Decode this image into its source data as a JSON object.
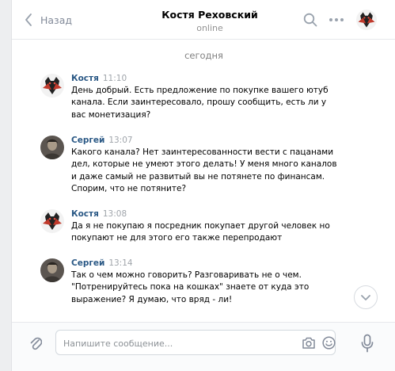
{
  "header": {
    "back_label": "Назад",
    "contact_name": "Костя Реховский",
    "status": "online"
  },
  "date_separator": "сегодня",
  "messages": [
    {
      "author": "Костя",
      "time": "11:10",
      "avatar": "kostya",
      "text": "День добрый. Есть предложение по покупке вашего ютуб канала. Если заинтересовало, прошу сообщить, есть ли у вас монетизация?"
    },
    {
      "author": "Сергей",
      "time": "13:07",
      "avatar": "sergey",
      "text": "Какого канала? Нет заинтересованности вести с пацанами дел, которые не умеют этого делать! У меня много каналов и даже самый не развитый вы не потянете по финансам. Спорим, что не потяните?"
    },
    {
      "author": "Костя",
      "time": "13:08",
      "avatar": "kostya",
      "text": "Да я не покупаю я посредник покупает другой человек но покупают не для этого его также перепродают"
    },
    {
      "author": "Сергей",
      "time": "13:14",
      "avatar": "sergey",
      "text": "Так о чем можно говорить? Разговаривать не о чем. \"Потренируйтесь пока на кошках\" знаете от куда это выражение? Я думаю, что вряд - ли!"
    }
  ],
  "composer": {
    "placeholder": "Напишите сообщение...",
    "value": ""
  },
  "colors": {
    "author": "#2a5885",
    "meta": "#a0a5ab",
    "icon": "#828a99",
    "background": "#edeef0"
  },
  "icons": [
    "back-chevron-icon",
    "search-icon",
    "more-icon",
    "attach-icon",
    "camera-icon",
    "smile-icon",
    "microphone-icon",
    "chevron-down-icon"
  ]
}
